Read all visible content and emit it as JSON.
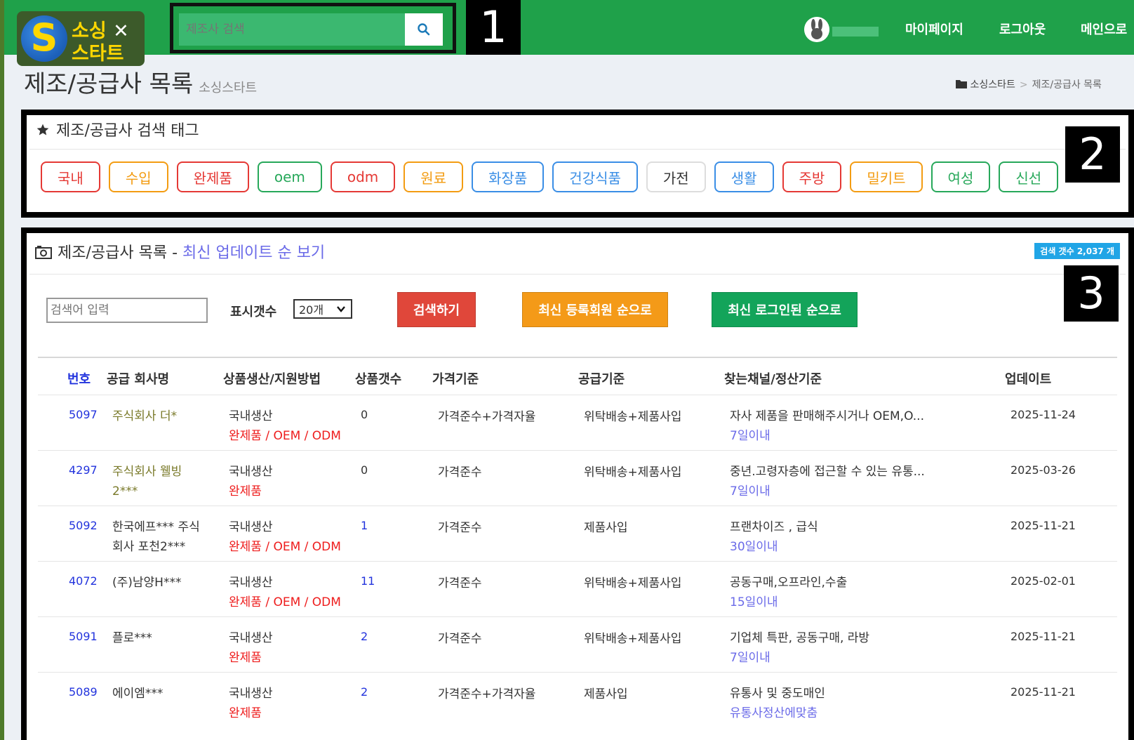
{
  "header": {
    "logo_line1": "소싱",
    "logo_x": "✕",
    "logo_line2": "스타트",
    "logo_letter": "S",
    "search_placeholder": "제조사 검색",
    "nav": {
      "mypage": "마이페이지",
      "logout": "로그아웃",
      "main": "메인으로"
    }
  },
  "callouts": [
    "1",
    "2",
    "3"
  ],
  "page": {
    "title": "제조/공급사 목록",
    "subtitle": "소싱스타트",
    "breadcrumb": {
      "home": "소싱스타트",
      "sep": ">",
      "current": "제조/공급사 목록"
    }
  },
  "tag_box": {
    "title": "제조/공급사 검색 태그",
    "tags": [
      {
        "label": "국내",
        "color": "#e53935"
      },
      {
        "label": "수입",
        "color": "#f39c12"
      },
      {
        "label": "완제품",
        "color": "#e53935"
      },
      {
        "label": "oem",
        "color": "#27a85a"
      },
      {
        "label": "odm",
        "color": "#e53935"
      },
      {
        "label": "원료",
        "color": "#f39c12"
      },
      {
        "label": "화장품",
        "color": "#3a8ee6"
      },
      {
        "label": "건강식품",
        "color": "#3a8ee6"
      },
      {
        "label": "가전",
        "color": "#dddddd"
      },
      {
        "label": "생활",
        "color": "#3a8ee6"
      },
      {
        "label": "주방",
        "color": "#e53935"
      },
      {
        "label": "밀키트",
        "color": "#f39c12"
      },
      {
        "label": "여성",
        "color": "#27a85a"
      },
      {
        "label": "신선",
        "color": "#27a85a"
      }
    ]
  },
  "list_box": {
    "title": "제조/공급사 목록",
    "title_sep": " - ",
    "title_accent": "최신 업데이트 순 보기",
    "count_badge": "검색 갯수 2,037 개",
    "keyword_placeholder": "검색어 입력",
    "display_label": "표시갯수",
    "display_value": "20개",
    "buttons": {
      "search": "검색하기",
      "newest_member": "최신 등록회원 순으로",
      "latest_login": "최신 로그인된 순으로"
    },
    "columns": {
      "num": "번호",
      "name": "공급 회사명",
      "method": "상품생산/지원방법",
      "count": "상품갯수",
      "price": "가격기준",
      "supply": "공급기준",
      "channel": "찾는채널/정산기준",
      "updated": "업데이트"
    },
    "rows": [
      {
        "num": "5097",
        "name1": "주식회사 더*",
        "name2": "",
        "method": "국내생산",
        "method_sub": "완제품 / OEM / ODM",
        "count": "0",
        "price": "가격준수+가격자율",
        "supply": "위탁배송+제품사입",
        "channel": "자사 제품을 판매해주시거나 OEM,O...",
        "channel_sub": "7일이내",
        "updated": "2025-11-24"
      },
      {
        "num": "4297",
        "name1": "주식회사 웰빙",
        "name2": "2***",
        "method": "국내생산",
        "method_sub": "완제품",
        "count": "0",
        "price": "가격준수",
        "supply": "위탁배송+제품사입",
        "channel": "중년.고령자층에 접근할 수 있는 유통...",
        "channel_sub": "7일이내",
        "updated": "2025-03-26"
      },
      {
        "num": "5092",
        "name1": "한국에프*** 주식",
        "name2": "회사 포천2***",
        "method": "국내생산",
        "method_sub": "완제품 / OEM / ODM",
        "count": "1",
        "price": "가격준수",
        "supply": "제품사입",
        "channel": "프랜차이즈 , 급식",
        "channel_sub": "30일이내",
        "updated": "2025-11-21"
      },
      {
        "num": "4072",
        "name1": "(주)남양H***",
        "name2": "",
        "method": "국내생산",
        "method_sub": "완제품 / OEM / ODM",
        "count": "11",
        "price": "가격준수",
        "supply": "위탁배송+제품사입",
        "channel": "공동구매,오프라인,수출",
        "channel_sub": "15일이내",
        "updated": "2025-02-01"
      },
      {
        "num": "5091",
        "name1": "플로***",
        "name2": "",
        "method": "국내생산",
        "method_sub": "완제품",
        "count": "2",
        "price": "가격준수",
        "supply": "위탁배송+제품사입",
        "channel": "기업체 특판, 공동구매, 라방",
        "channel_sub": "7일이내",
        "updated": "2025-11-21"
      },
      {
        "num": "5089",
        "name1": "에이엠***",
        "name2": "",
        "method": "국내생산",
        "method_sub": "완제품",
        "count": "2",
        "price": "가격준수+가격자율",
        "supply": "제품사입",
        "channel": "유통사 및 중도매인",
        "channel_sub": "유통사정산에맞춤",
        "updated": "2025-11-21"
      }
    ]
  }
}
